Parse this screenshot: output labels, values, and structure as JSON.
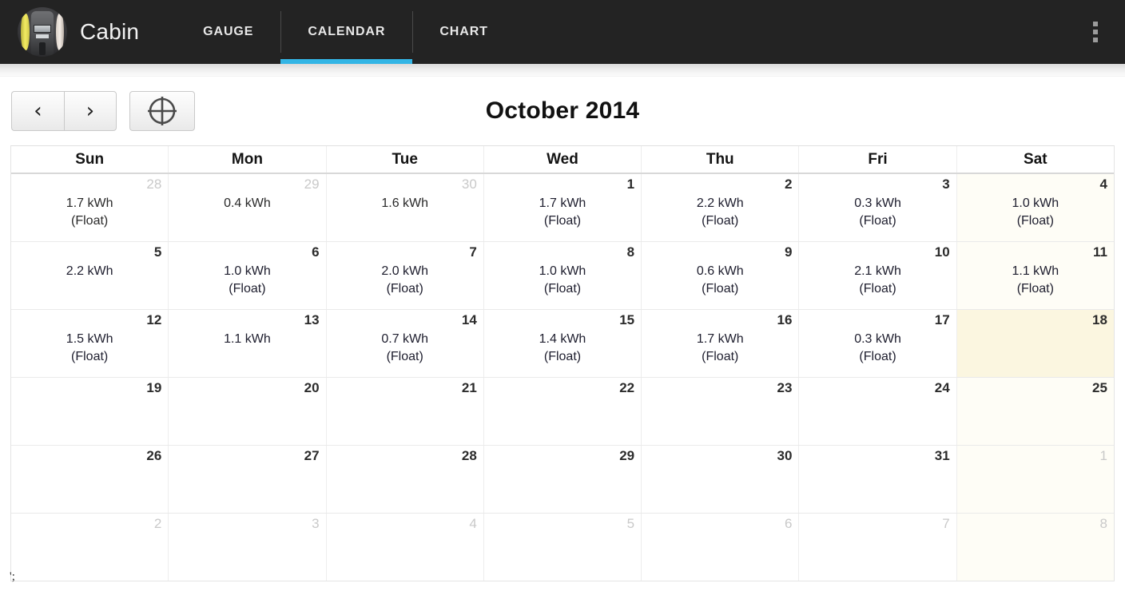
{
  "app": {
    "title": "Cabin",
    "icon": "electric-meter-icon",
    "accent_color": "#33b5e5",
    "toolbar_bg": "#232323"
  },
  "tabs": [
    {
      "label": "GAUGE",
      "active": false
    },
    {
      "label": "CALENDAR",
      "active": true
    },
    {
      "label": "CHART",
      "active": false
    }
  ],
  "overflow_menu": {
    "icon": "overflow-menu-icon",
    "label": "More options"
  },
  "nav": {
    "prev_label": "‹",
    "next_label": "›",
    "today_icon": "crosshair-target-icon",
    "month_title": "October 2014"
  },
  "calendar": {
    "weekday_headers": [
      "Sun",
      "Mon",
      "Tue",
      "Wed",
      "Thu",
      "Fri",
      "Sat"
    ],
    "today_highlight_color": "#fbf6e0",
    "weeks": [
      [
        {
          "day": "28",
          "kwh": "1.7 kWh",
          "state": "(Float)",
          "muted": true,
          "today": false
        },
        {
          "day": "29",
          "kwh": "0.4 kWh",
          "state": "",
          "muted": true,
          "today": false
        },
        {
          "day": "30",
          "kwh": "1.6 kWh",
          "state": "",
          "muted": true,
          "today": false
        },
        {
          "day": "1",
          "kwh": "1.7 kWh",
          "state": "(Float)",
          "muted": false,
          "today": false
        },
        {
          "day": "2",
          "kwh": "2.2 kWh",
          "state": "(Float)",
          "muted": false,
          "today": false
        },
        {
          "day": "3",
          "kwh": "0.3 kWh",
          "state": "(Float)",
          "muted": false,
          "today": false
        },
        {
          "day": "4",
          "kwh": "1.0 kWh",
          "state": "(Float)",
          "muted": false,
          "today": false
        }
      ],
      [
        {
          "day": "5",
          "kwh": "2.2 kWh",
          "state": "",
          "muted": false,
          "today": false
        },
        {
          "day": "6",
          "kwh": "1.0 kWh",
          "state": "(Float)",
          "muted": false,
          "today": false
        },
        {
          "day": "7",
          "kwh": "2.0 kWh",
          "state": "(Float)",
          "muted": false,
          "today": false
        },
        {
          "day": "8",
          "kwh": "1.0 kWh",
          "state": "(Float)",
          "muted": false,
          "today": false
        },
        {
          "day": "9",
          "kwh": "0.6 kWh",
          "state": "(Float)",
          "muted": false,
          "today": false
        },
        {
          "day": "10",
          "kwh": "2.1 kWh",
          "state": "(Float)",
          "muted": false,
          "today": false
        },
        {
          "day": "11",
          "kwh": "1.1 kWh",
          "state": "(Float)",
          "muted": false,
          "today": false
        }
      ],
      [
        {
          "day": "12",
          "kwh": "1.5 kWh",
          "state": "(Float)",
          "muted": false,
          "today": false
        },
        {
          "day": "13",
          "kwh": "1.1 kWh",
          "state": "",
          "muted": false,
          "today": false
        },
        {
          "day": "14",
          "kwh": "0.7 kWh",
          "state": "(Float)",
          "muted": false,
          "today": false
        },
        {
          "day": "15",
          "kwh": "1.4 kWh",
          "state": "(Float)",
          "muted": false,
          "today": false
        },
        {
          "day": "16",
          "kwh": "1.7 kWh",
          "state": "(Float)",
          "muted": false,
          "today": false
        },
        {
          "day": "17",
          "kwh": "0.3 kWh",
          "state": "(Float)",
          "muted": false,
          "today": false
        },
        {
          "day": "18",
          "kwh": "",
          "state": "",
          "muted": false,
          "today": true
        }
      ],
      [
        {
          "day": "19",
          "kwh": "",
          "state": "",
          "muted": false,
          "today": false
        },
        {
          "day": "20",
          "kwh": "",
          "state": "",
          "muted": false,
          "today": false
        },
        {
          "day": "21",
          "kwh": "",
          "state": "",
          "muted": false,
          "today": false
        },
        {
          "day": "22",
          "kwh": "",
          "state": "",
          "muted": false,
          "today": false
        },
        {
          "day": "23",
          "kwh": "",
          "state": "",
          "muted": false,
          "today": false
        },
        {
          "day": "24",
          "kwh": "",
          "state": "",
          "muted": false,
          "today": false
        },
        {
          "day": "25",
          "kwh": "",
          "state": "",
          "muted": false,
          "today": false
        }
      ],
      [
        {
          "day": "26",
          "kwh": "",
          "state": "",
          "muted": false,
          "today": false
        },
        {
          "day": "27",
          "kwh": "",
          "state": "",
          "muted": false,
          "today": false
        },
        {
          "day": "28",
          "kwh": "",
          "state": "",
          "muted": false,
          "today": false
        },
        {
          "day": "29",
          "kwh": "",
          "state": "",
          "muted": false,
          "today": false
        },
        {
          "day": "30",
          "kwh": "",
          "state": "",
          "muted": false,
          "today": false
        },
        {
          "day": "31",
          "kwh": "",
          "state": "",
          "muted": false,
          "today": false
        },
        {
          "day": "1",
          "kwh": "",
          "state": "",
          "muted": true,
          "today": false
        }
      ],
      [
        {
          "day": "2",
          "kwh": "",
          "state": "",
          "muted": true,
          "today": false
        },
        {
          "day": "3",
          "kwh": "",
          "state": "",
          "muted": true,
          "today": false
        },
        {
          "day": "4",
          "kwh": "",
          "state": "",
          "muted": true,
          "today": false
        },
        {
          "day": "5",
          "kwh": "",
          "state": "",
          "muted": true,
          "today": false
        },
        {
          "day": "6",
          "kwh": "",
          "state": "",
          "muted": true,
          "today": false
        },
        {
          "day": "7",
          "kwh": "",
          "state": "",
          "muted": true,
          "today": false
        },
        {
          "day": "8",
          "kwh": "",
          "state": "",
          "muted": true,
          "today": false
        }
      ]
    ]
  },
  "artifact": {
    "text": "';"
  }
}
